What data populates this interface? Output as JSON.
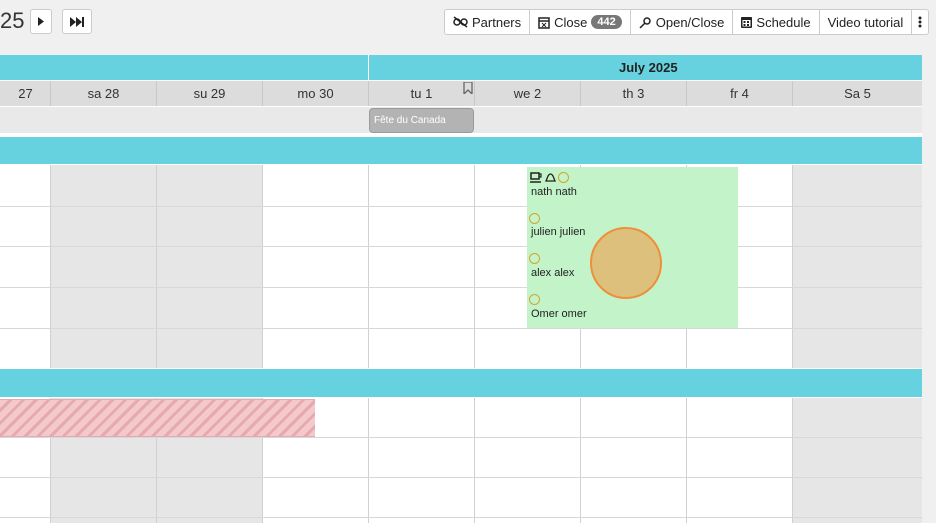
{
  "toolbar": {
    "year_fragment": "25",
    "next_icon": "play-icon",
    "fast_forward_icon": "fast-forward-icon",
    "partners_label": "Partners",
    "close_label": "Close",
    "close_count": "442",
    "open_close_label": "Open/Close",
    "schedule_label": "Schedule",
    "video_tutorial_label": "Video tutorial",
    "more_icon": "more-vertical-icon"
  },
  "calendar": {
    "month_label": "July 2025",
    "days": [
      {
        "label": "27",
        "weekend": false
      },
      {
        "label": "sa 28",
        "weekend": true
      },
      {
        "label": "su 29",
        "weekend": true
      },
      {
        "label": "mo 30",
        "weekend": false
      },
      {
        "label": "tu 1",
        "weekend": false
      },
      {
        "label": "we 2",
        "weekend": false
      },
      {
        "label": "th 3",
        "weekend": false
      },
      {
        "label": "fr 4",
        "weekend": false
      },
      {
        "label": "Sa 5",
        "weekend": true
      }
    ],
    "holiday": "Fête du Canada",
    "people": [
      {
        "name": "nath nath",
        "icons": [
          "cup-icon",
          "bell-icon",
          "circle-icon"
        ]
      },
      {
        "name": "julien julien",
        "icons": [
          "circle-icon"
        ]
      },
      {
        "name": "alex alex",
        "icons": [
          "circle-icon"
        ]
      },
      {
        "name": "Omer omer",
        "icons": [
          "circle-icon"
        ]
      }
    ]
  },
  "colors": {
    "teal": "#66d1df",
    "green": "#c3f3c9",
    "hatch": "#f3c9cb",
    "cursor": "#ee8f3a"
  }
}
